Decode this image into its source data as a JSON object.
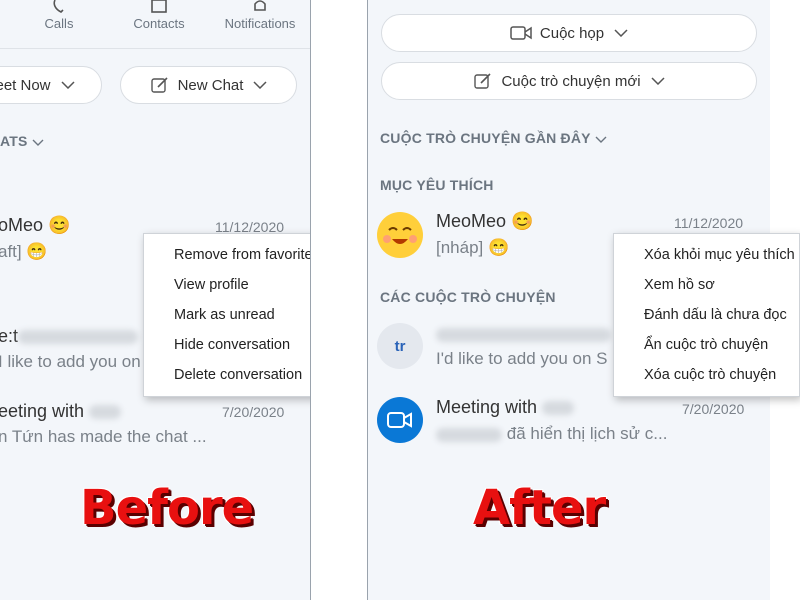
{
  "colors": {
    "panel_bg": "#f3f6fa",
    "accent": "#0078d4",
    "caption_red": "#e81010"
  },
  "before": {
    "nav_tabs": [
      {
        "label": "Calls",
        "icon": "phone-icon"
      },
      {
        "label": "Contacts",
        "icon": "contacts-icon"
      },
      {
        "label": "Notifications",
        "icon": "bell-icon"
      }
    ],
    "meet_now_label": "eet Now",
    "new_chat_label": "New Chat",
    "section_label": "ATS",
    "chats": [
      {
        "name": "oMeo",
        "emoji": "😊",
        "subtitle": "aft]",
        "subtitle_emoji": "😁",
        "date": "11/12/2020"
      },
      {
        "name": "e:t",
        "subtitle": "I like to add you on"
      },
      {
        "name": "eeting with",
        "subtitle": "n Tứn has made the chat ...",
        "date": "7/20/2020"
      }
    ],
    "context_menu": [
      "Remove from favorites",
      "View profile",
      "Mark as unread",
      "Hide conversation",
      "Delete conversation"
    ],
    "caption": "Before"
  },
  "after": {
    "meeting_label": "Cuộc họp",
    "new_chat_label": "Cuộc trò chuyện mới",
    "recent_label": "CUỘC TRÒ CHUYỆN GẦN ĐÂY",
    "favorites_label": "MỤC YÊU THÍCH",
    "conversations_label": "CÁC CUỘC TRÒ CHUYỆN",
    "chats": [
      {
        "name": "MeoMeo",
        "emoji": "😊",
        "subtitle": "[nháp]",
        "subtitle_emoji": "😁",
        "date": "11/12/2020"
      },
      {
        "avatar_initials": "tr",
        "subtitle": "I'd like to add you on S"
      },
      {
        "name": "Meeting with",
        "subtitle": "đã hiển thị lịch sử c...",
        "date": "7/20/2020"
      }
    ],
    "context_menu": [
      "Xóa khỏi mục yêu thích",
      "Xem hồ sơ",
      "Đánh dấu là chưa đọc",
      "Ẩn cuộc trò chuyện",
      "Xóa cuộc trò chuyện"
    ],
    "caption": "After"
  }
}
